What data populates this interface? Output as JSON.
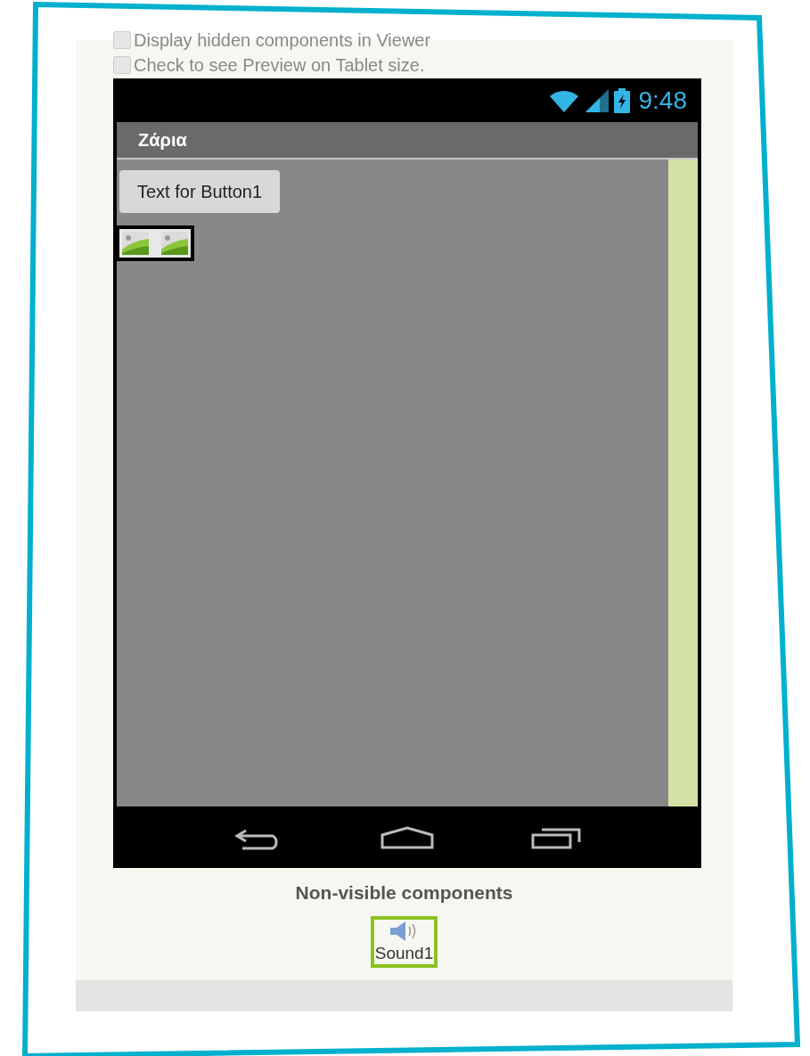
{
  "options": [
    {
      "label": "Display hidden components in Viewer",
      "checked": false
    },
    {
      "label": "Check to see Preview on Tablet size.",
      "checked": false
    }
  ],
  "phone": {
    "time": "9:48",
    "title": "Ζάρια",
    "button": "Text for Button1"
  },
  "non_visible": {
    "heading": "Non-visible components",
    "items": [
      {
        "label": "Sound1",
        "selected": true
      }
    ]
  }
}
